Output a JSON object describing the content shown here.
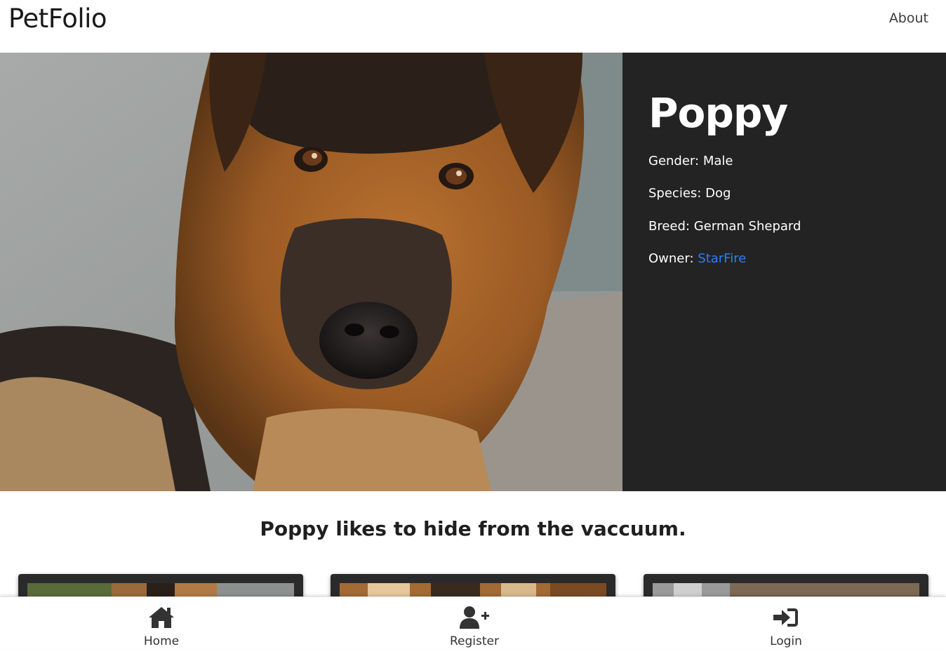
{
  "header": {
    "brand": "PetFolio",
    "nav": {
      "about_label": "About"
    }
  },
  "pet": {
    "name": "Poppy",
    "gender_label": "Gender:",
    "gender": "Male",
    "species_label": "Species:",
    "species": "Dog",
    "breed_label": "Breed:",
    "breed": "German Shepard",
    "owner_label": "Owner:",
    "owner": "StarFire",
    "bio": "Poppy likes to hide from the vaccuum."
  },
  "gallery": {
    "cards": [
      "photo-1",
      "photo-2",
      "photo-3"
    ]
  },
  "bottom_nav": {
    "items": [
      {
        "label": "Home",
        "icon": "home-icon"
      },
      {
        "label": "Register",
        "icon": "user-plus-icon"
      },
      {
        "label": "Login",
        "icon": "sign-in-icon"
      }
    ]
  },
  "colors": {
    "panel_bg": "#232323",
    "link": "#2f7df6",
    "icon": "#333333"
  }
}
